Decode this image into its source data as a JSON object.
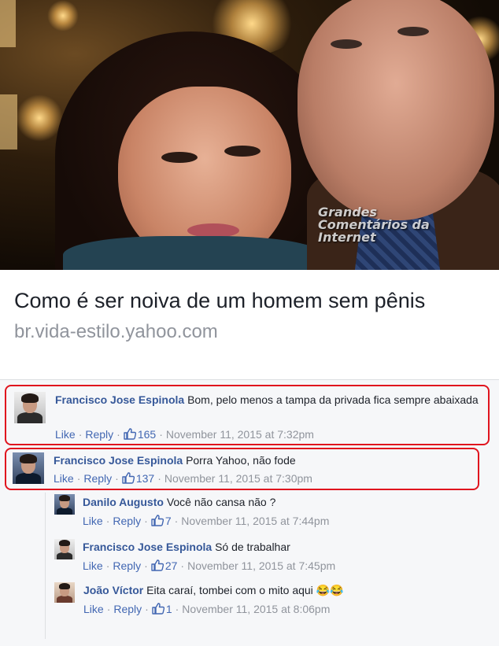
{
  "photo": {
    "watermark_lines": [
      "Grandes",
      "Comentários da",
      "Internet"
    ]
  },
  "preview": {
    "title": "Como é ser noiva de um homem sem pênis",
    "domain": "br.vida-estilo.yahoo.com"
  },
  "comments": [
    {
      "author": "Francisco Jose Espinola",
      "text": "Bom, pelo menos a tampa da privada fica sempre abaixada",
      "like_label": "Like",
      "reply_label": "Reply",
      "likes": "165",
      "timestamp": "November 11, 2015 at 7:32pm"
    },
    {
      "author": "Francisco Jose Espinola",
      "text": "Porra Yahoo, não fode",
      "like_label": "Like",
      "reply_label": "Reply",
      "likes": "137",
      "timestamp": "November 11, 2015 at 7:30pm",
      "replies": [
        {
          "author": "Danilo Augusto",
          "text": "Você não cansa não ?",
          "like_label": "Like",
          "reply_label": "Reply",
          "likes": "7",
          "timestamp": "November 11, 2015 at 7:44pm"
        },
        {
          "author": "Francisco Jose Espinola",
          "text": "Só de trabalhar",
          "like_label": "Like",
          "reply_label": "Reply",
          "likes": "27",
          "timestamp": "November 11, 2015 at 7:45pm"
        },
        {
          "author": "João Víctor",
          "text": "Eita caraí, tombei com o mito aqui",
          "emoji": "😂😂",
          "like_label": "Like",
          "reply_label": "Reply",
          "likes": "1",
          "timestamp": "November 11, 2015 at 8:06pm"
        }
      ]
    }
  ],
  "colors": {
    "author_link": "#365899",
    "action_link": "#4267b2",
    "meta_gray": "#90949c",
    "highlight_red": "#e0141e"
  },
  "icons": {
    "like": "thumbs-up-icon"
  }
}
